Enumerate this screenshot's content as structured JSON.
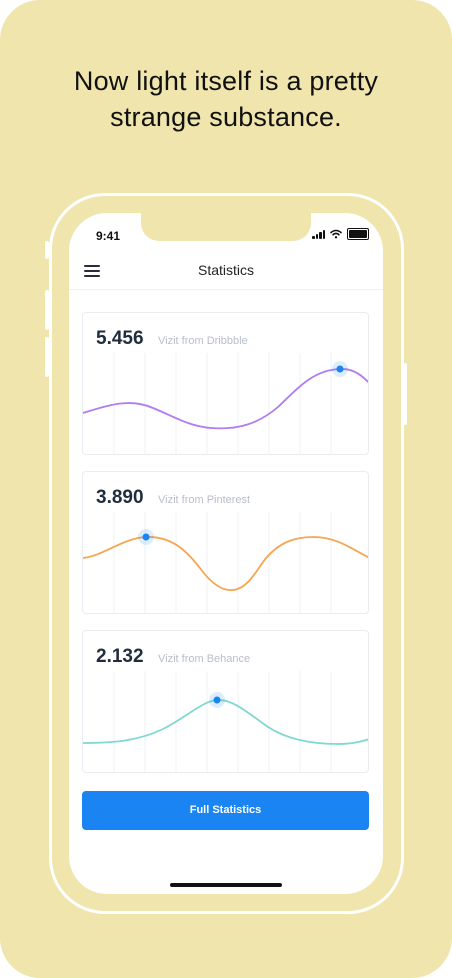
{
  "headline": {
    "line1": "Now light itself is a pretty",
    "line2": "strange substance."
  },
  "status_bar": {
    "time": "9:41",
    "icons": [
      "cellular-signal-icon",
      "wifi-icon",
      "battery-icon"
    ]
  },
  "nav": {
    "title": "Statistics",
    "menu_icon": "hamburger-menu-icon"
  },
  "cards": [
    {
      "value": "5.456",
      "label": "Vizit from Dribbble",
      "color": "#b07cf0"
    },
    {
      "value": "3.890",
      "label": "Vizit from Pinterest",
      "color": "#f4a651"
    },
    {
      "value": "2.132",
      "label": "Vizit from Behance",
      "color": "#7fd8d2"
    }
  ],
  "button": {
    "label": "Full Statistics",
    "color": "#1a84f2"
  },
  "colors": {
    "background": "#efe5ad",
    "highlight_dot": "#1a84f2"
  }
}
